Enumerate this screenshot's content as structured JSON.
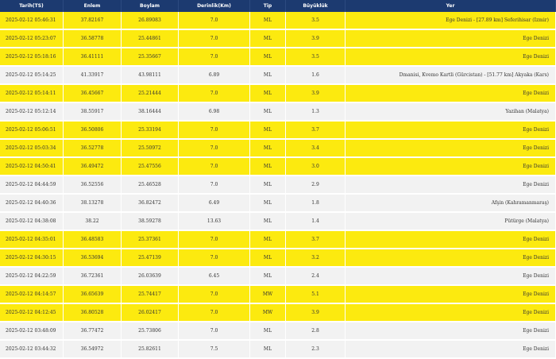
{
  "table": {
    "headers": {
      "date": "Tarih(TS)",
      "lat": "Enlem",
      "lon": "Boylam",
      "depth": "Derinlik(Km)",
      "type": "Tip",
      "mag": "Büyüklük",
      "place": "Yer"
    },
    "highlight_color": "#fcea0f",
    "header_color": "#1c3a70",
    "rows": [
      {
        "date": "2025-02-12 05:46:31",
        "lat": "37.82167",
        "lon": "26.89083",
        "depth": "7.0",
        "type": "ML",
        "mag": "3.5",
        "place": "Ege Denizi - [27.89 km] Seferihisar (Izmir)",
        "highlight": true
      },
      {
        "date": "2025-02-12 05:23:07",
        "lat": "36.58778",
        "lon": "25.44861",
        "depth": "7.0",
        "type": "ML",
        "mag": "3.9",
        "place": "Ege Denizi",
        "highlight": true
      },
      {
        "date": "2025-02-12 05:18:16",
        "lat": "36.41111",
        "lon": "25.35667",
        "depth": "7.0",
        "type": "ML",
        "mag": "3.5",
        "place": "Ege Denizi",
        "highlight": true
      },
      {
        "date": "2025-02-12 05:14:25",
        "lat": "41.33917",
        "lon": "43.98111",
        "depth": "6.89",
        "type": "ML",
        "mag": "1.6",
        "place": "Dmanisi, Kvemo Kartli (Gürcistan) - [51.77 km] Akyaka (Kars)",
        "highlight": false
      },
      {
        "date": "2025-02-12 05:14:11",
        "lat": "36.45667",
        "lon": "25.21444",
        "depth": "7.0",
        "type": "ML",
        "mag": "3.9",
        "place": "Ege Denizi",
        "highlight": true
      },
      {
        "date": "2025-02-12 05:12:14",
        "lat": "38.55917",
        "lon": "38.16444",
        "depth": "6.98",
        "type": "ML",
        "mag": "1.3",
        "place": "Yazihan (Malatya)",
        "highlight": false
      },
      {
        "date": "2025-02-12 05:06:51",
        "lat": "36.50806",
        "lon": "25.33194",
        "depth": "7.0",
        "type": "ML",
        "mag": "3.7",
        "place": "Ege Denizi",
        "highlight": true
      },
      {
        "date": "2025-02-12 05:03:34",
        "lat": "36.52778",
        "lon": "25.50972",
        "depth": "7.0",
        "type": "ML",
        "mag": "3.4",
        "place": "Ege Denizi",
        "highlight": true
      },
      {
        "date": "2025-02-12 04:50:41",
        "lat": "36.49472",
        "lon": "25.47556",
        "depth": "7.0",
        "type": "ML",
        "mag": "3.0",
        "place": "Ege Denizi",
        "highlight": true
      },
      {
        "date": "2025-02-12 04:44:59",
        "lat": "36.52556",
        "lon": "25.46528",
        "depth": "7.0",
        "type": "ML",
        "mag": "2.9",
        "place": "Ege Denizi",
        "highlight": false
      },
      {
        "date": "2025-02-12 04:40:36",
        "lat": "38.13278",
        "lon": "36.82472",
        "depth": "6.49",
        "type": "ML",
        "mag": "1.8",
        "place": "Afşin (Kahramanmaraş)",
        "highlight": false
      },
      {
        "date": "2025-02-12 04:38:08",
        "lat": "38.22",
        "lon": "38.59278",
        "depth": "13.63",
        "type": "ML",
        "mag": "1.4",
        "place": "Pütürge (Malatya)",
        "highlight": false
      },
      {
        "date": "2025-02-12 04:35:01",
        "lat": "36.48583",
        "lon": "25.37361",
        "depth": "7.0",
        "type": "ML",
        "mag": "3.7",
        "place": "Ege Denizi",
        "highlight": true
      },
      {
        "date": "2025-02-12 04:30:15",
        "lat": "36.53694",
        "lon": "25.47139",
        "depth": "7.0",
        "type": "ML",
        "mag": "3.2",
        "place": "Ege Denizi",
        "highlight": true
      },
      {
        "date": "2025-02-12 04:22:59",
        "lat": "36.72361",
        "lon": "26.03639",
        "depth": "6.45",
        "type": "ML",
        "mag": "2.4",
        "place": "Ege Denizi",
        "highlight": false
      },
      {
        "date": "2025-02-12 04:14:57",
        "lat": "36.65639",
        "lon": "25.74417",
        "depth": "7.0",
        "type": "MW",
        "mag": "5.1",
        "place": "Ege Denizi",
        "highlight": true
      },
      {
        "date": "2025-02-12 04:12:45",
        "lat": "36.80528",
        "lon": "26.02417",
        "depth": "7.0",
        "type": "MW",
        "mag": "3.9",
        "place": "Ege Denizi",
        "highlight": true
      },
      {
        "date": "2025-02-12 03:48:09",
        "lat": "36.77472",
        "lon": "25.73806",
        "depth": "7.0",
        "type": "ML",
        "mag": "2.8",
        "place": "Ege Denizi",
        "highlight": false
      },
      {
        "date": "2025-02-12 03:44:32",
        "lat": "36.54972",
        "lon": "25.82611",
        "depth": "7.5",
        "type": "ML",
        "mag": "2.3",
        "place": "Ege Denizi",
        "highlight": false
      }
    ]
  }
}
